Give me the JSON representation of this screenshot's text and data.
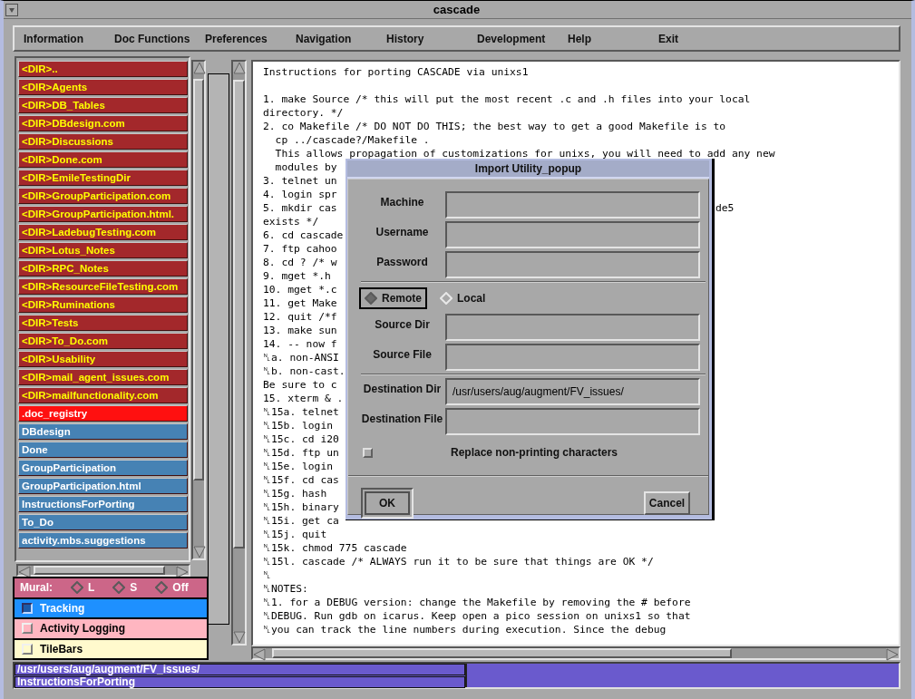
{
  "window": {
    "title": "cascade"
  },
  "menu": [
    "Information",
    "Doc Functions",
    "Preferences",
    "Navigation",
    "History",
    "Development",
    "Help",
    "Exit"
  ],
  "file_list": [
    {
      "label": "<DIR>..",
      "kind": "dir",
      "selected": false
    },
    {
      "label": "<DIR>Agents",
      "kind": "dir",
      "selected": false
    },
    {
      "label": "<DIR>DB_Tables",
      "kind": "dir",
      "selected": false
    },
    {
      "label": "<DIR>DBdesign.com",
      "kind": "dir",
      "selected": false
    },
    {
      "label": "<DIR>Discussions",
      "kind": "dir",
      "selected": false
    },
    {
      "label": "<DIR>Done.com",
      "kind": "dir",
      "selected": false
    },
    {
      "label": "<DIR>EmileTestingDir",
      "kind": "dir",
      "selected": false
    },
    {
      "label": "<DIR>GroupParticipation.com",
      "kind": "dir",
      "selected": false
    },
    {
      "label": "<DIR>GroupParticipation.html.",
      "kind": "dir",
      "selected": false
    },
    {
      "label": "<DIR>LadebugTesting.com",
      "kind": "dir",
      "selected": false
    },
    {
      "label": "<DIR>Lotus_Notes",
      "kind": "dir",
      "selected": false
    },
    {
      "label": "<DIR>RPC_Notes",
      "kind": "dir",
      "selected": false
    },
    {
      "label": "<DIR>ResourceFileTesting.com",
      "kind": "dir",
      "selected": false
    },
    {
      "label": "<DIR>Ruminations",
      "kind": "dir",
      "selected": false
    },
    {
      "label": "<DIR>Tests",
      "kind": "dir",
      "selected": false
    },
    {
      "label": "<DIR>To_Do.com",
      "kind": "dir",
      "selected": false
    },
    {
      "label": "<DIR>Usability",
      "kind": "dir",
      "selected": false
    },
    {
      "label": "<DIR>mail_agent_issues.com",
      "kind": "dir",
      "selected": false
    },
    {
      "label": "<DIR>mailfunctionality.com",
      "kind": "dir",
      "selected": false
    },
    {
      "label": ".doc_registry",
      "kind": "file",
      "selected": true
    },
    {
      "label": "DBdesign",
      "kind": "file",
      "selected": false
    },
    {
      "label": "Done",
      "kind": "file",
      "selected": false
    },
    {
      "label": "GroupParticipation",
      "kind": "file",
      "selected": false
    },
    {
      "label": "GroupParticipation.html",
      "kind": "file",
      "selected": false
    },
    {
      "label": "InstructionsForPorting",
      "kind": "file",
      "selected": false
    },
    {
      "label": "To_Do",
      "kind": "file",
      "selected": false
    },
    {
      "label": "activity.mbs.suggestions",
      "kind": "file",
      "selected": false
    }
  ],
  "mural": {
    "label": "Mural:",
    "options": [
      {
        "label": "L",
        "selected": false
      },
      {
        "label": "S",
        "selected": false
      },
      {
        "label": "Off",
        "selected": false
      }
    ]
  },
  "toggles": [
    {
      "label": "Tracking",
      "checked": true,
      "color": "#1e90ff"
    },
    {
      "label": "Activity Logging",
      "checked": false,
      "color": "#ffb6c1"
    },
    {
      "label": "TileBars",
      "checked": false,
      "color": "#fffacd"
    }
  ],
  "document": {
    "heading": "Instructions for porting CASCADE via unixs1",
    "lines": [
      {
        "text": "1. make Source /* this will put the most recent .c and .h files into your local"
      },
      {
        "text": "directory. */"
      },
      {
        "text": "2. co Makefile /* DO NOT DO THIS; the best way to get a good Makefile is to"
      },
      {
        "text": "  cp ../cascade?/Makefile ."
      },
      {
        "text": "  This allows propagation of customizations for unixs, you will need to add any new"
      },
      {
        "text": "  modules by"
      },
      {
        "text": "3. telnet un"
      },
      {
        "text": "4. login spr"
      },
      {
        "text": "5. mkdir cas",
        "tail": "de5"
      },
      {
        "text": "exists */"
      },
      {
        "text": "6. cd cascade"
      },
      {
        "text": "7. ftp cahoo"
      },
      {
        "text": "8. cd ? /* w"
      },
      {
        "text": "9. mget *.h"
      },
      {
        "text": "10. mget *.c"
      },
      {
        "text": "11. get Make"
      },
      {
        "text": "12. quit /*f"
      },
      {
        "text": "13. make sun"
      },
      {
        "text": "14. -- now f"
      },
      {
        "text": "␤a. non-ANSI"
      },
      {
        "text": "␤b. non-cast."
      },
      {
        "text": "Be sure to c"
      },
      {
        "text": "15. xterm & ."
      },
      {
        "text": "␤15a. telnet"
      },
      {
        "text": "␤15b. login"
      },
      {
        "text": "␤15c. cd i20"
      },
      {
        "text": "␤15d. ftp un"
      },
      {
        "text": "␤15e. login"
      },
      {
        "text": "␤15f. cd cas"
      },
      {
        "text": "␤15g. hash"
      },
      {
        "text": "␤15h. binary"
      },
      {
        "text": "␤15i. get ca"
      },
      {
        "text": "␤15j. quit"
      },
      {
        "text": "␤15k. chmod 775 cascade"
      },
      {
        "text": "␤15l. cascade /* ALWAYS run it to be sure that things are OK */"
      },
      {
        "text": "␤"
      },
      {
        "text": "␤NOTES:"
      },
      {
        "text": "␤1. for a DEBUG version: change the Makefile by removing the # before"
      },
      {
        "text": "␤DEBUG. Run gdb on icarus. Keep open a pico session on unixs1 so that"
      },
      {
        "text": "␤you can track the line numbers during execution. Since the debug"
      }
    ]
  },
  "popup": {
    "title": "Import Utility_popup",
    "login_fields": [
      {
        "label": "Machine"
      },
      {
        "label": "Username"
      },
      {
        "label": "Password"
      }
    ],
    "location": [
      {
        "label": "Remote",
        "selected": true
      },
      {
        "label": "Local",
        "selected": false
      }
    ],
    "path_fields": [
      {
        "label": "Source Dir"
      },
      {
        "label": "Source File"
      },
      {
        "label": "Destination Dir",
        "value": "/usr/users/aug/augment/FV_issues/"
      },
      {
        "label": "Destination File"
      }
    ],
    "option": {
      "label": "Replace non-printing characters",
      "checked": false
    },
    "buttons": [
      {
        "label": "OK",
        "default": true
      },
      {
        "label": "Cancel",
        "default": false
      }
    ]
  },
  "status_bar": {
    "lines": [
      "/usr/users/aug/augment/FV_issues/",
      "InstructionsForPorting"
    ]
  }
}
